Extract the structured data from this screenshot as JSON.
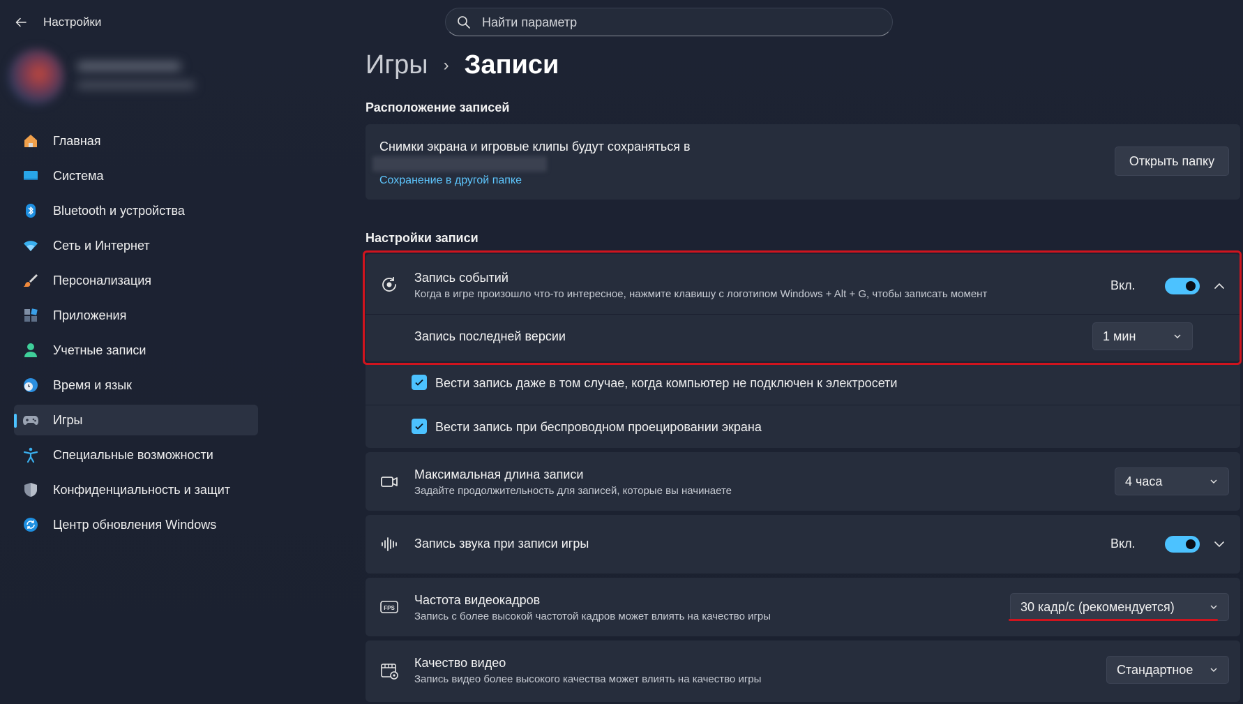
{
  "window": {
    "title": "Настройки"
  },
  "search": {
    "placeholder": "Найти параметр"
  },
  "sidebar": {
    "items": [
      {
        "label": "Главная",
        "icon": "home-icon"
      },
      {
        "label": "Система",
        "icon": "system-icon"
      },
      {
        "label": "Bluetooth и устройства",
        "icon": "bluetooth-icon"
      },
      {
        "label": "Сеть и Интернет",
        "icon": "wifi-icon"
      },
      {
        "label": "Персонализация",
        "icon": "brush-icon"
      },
      {
        "label": "Приложения",
        "icon": "apps-icon"
      },
      {
        "label": "Учетные записи",
        "icon": "account-icon"
      },
      {
        "label": "Время и язык",
        "icon": "time-language-icon"
      },
      {
        "label": "Игры",
        "icon": "gamepad-icon",
        "active": true
      },
      {
        "label": "Специальные возможности",
        "icon": "accessibility-icon"
      },
      {
        "label": "Конфиденциальность и защит",
        "icon": "shield-icon"
      },
      {
        "label": "Центр обновления Windows",
        "icon": "update-icon"
      }
    ]
  },
  "breadcrumb": {
    "parent": "Игры",
    "separator": "›",
    "current": "Записи"
  },
  "location_section": {
    "title": "Расположение записей",
    "description": "Снимки экрана и игровые клипы будут сохраняться в",
    "link": "Сохранение в другой папке",
    "button": "Открыть папку"
  },
  "record_section": {
    "title": "Настройки записи",
    "event_recording": {
      "title": "Запись событий",
      "description": "Когда в игре произошло что-то интересное, нажмите клавишу с логотипом Windows + Alt + G, чтобы записать момент",
      "toggle_label": "Вкл.",
      "toggle_on": true,
      "sub_label": "Запись последней версии",
      "sub_value": "1 мин"
    },
    "checkboxes": [
      {
        "label": "Вести запись даже в том случае, когда компьютер не подключен к электросети",
        "checked": true
      },
      {
        "label": "Вести запись при беспроводном проецировании экрана",
        "checked": true
      }
    ],
    "max_length": {
      "title": "Максимальная длина записи",
      "description": "Задайте продолжительность для записей, которые вы начинаете",
      "value": "4 часа"
    },
    "audio": {
      "title": "Запись звука при записи игры",
      "toggle_label": "Вкл.",
      "toggle_on": true
    },
    "fps": {
      "title": "Частота видеокадров",
      "description": "Запись с более высокой частотой кадров может влиять на качество игры",
      "value": "30 кадр/с (рекомендуется)"
    },
    "quality": {
      "title": "Качество видео",
      "description": "Запись видео более высокого качества может влиять на качество игры",
      "value": "Стандартное"
    }
  },
  "colors": {
    "accent": "#4cc2ff",
    "annotation": "#d0141e",
    "background": "#1c2231",
    "card": "#262d3c"
  }
}
